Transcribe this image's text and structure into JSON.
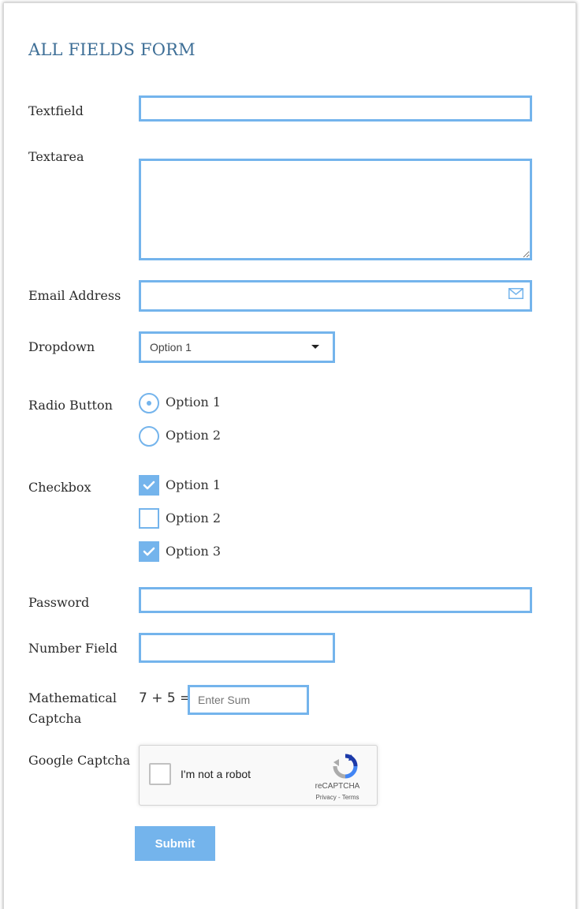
{
  "form": {
    "title": "ALL FIELDS FORM",
    "textfield": {
      "label": "Textfield",
      "value": ""
    },
    "textarea": {
      "label": "Textarea",
      "value": ""
    },
    "email": {
      "label": "Email Address",
      "value": "",
      "icon": "envelope-icon"
    },
    "dropdown": {
      "label": "Dropdown",
      "selected": "Option 1"
    },
    "radio": {
      "label": "Radio Button",
      "options": [
        {
          "label": "Option 1",
          "selected": true
        },
        {
          "label": "Option 2",
          "selected": false
        }
      ]
    },
    "checkbox": {
      "label": "Checkbox",
      "options": [
        {
          "label": "Option 1",
          "checked": true
        },
        {
          "label": "Option 2",
          "checked": false
        },
        {
          "label": "Option 3",
          "checked": true
        }
      ]
    },
    "password": {
      "label": "Password",
      "value": ""
    },
    "number": {
      "label": "Number Field",
      "value": ""
    },
    "math_captcha": {
      "label_line1": "Mathematical",
      "label_line2": "Captcha",
      "expression": "7 + 5 =",
      "placeholder": "Enter Sum"
    },
    "google_captcha": {
      "label": "Google Captcha",
      "checkbox_text": "I'm not a robot",
      "brand": "reCAPTCHA",
      "links": "Privacy - Terms"
    },
    "submit_label": "Submit"
  },
  "colors": {
    "accent": "#74b4ec",
    "title": "#3d6e96"
  }
}
